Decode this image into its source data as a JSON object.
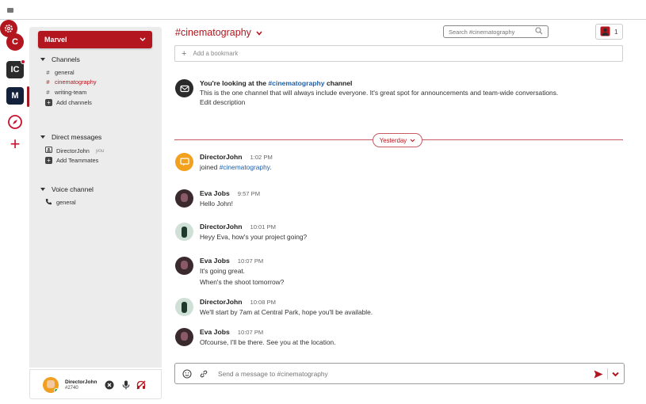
{
  "servers": [
    {
      "letter": "C",
      "name": "C"
    },
    {
      "letter": "IC",
      "name": "IC"
    },
    {
      "letter": "M",
      "name": "M"
    }
  ],
  "workspace": {
    "name": "Marvel"
  },
  "sidebar": {
    "channels_label": "Channels",
    "channels": [
      "general",
      "cinematography",
      "writing-team"
    ],
    "add_channels": "Add channels",
    "dm_label": "Direct messages",
    "dm_user": "DirectorJohn",
    "dm_you": "you",
    "add_teammates": "Add Teammates",
    "voice_label": "Voice channel",
    "voice_channels": [
      "general"
    ]
  },
  "user": {
    "name": "DirectorJohn",
    "tag": "#2740"
  },
  "header": {
    "channel": "#cinematography",
    "search_placeholder": "Search #cinematography",
    "member_count": "1",
    "bookmark": "Add a bookmark"
  },
  "intro": {
    "title_prefix": "You're looking at the ",
    "title_channel": "#cinematography",
    "title_suffix": " channel",
    "description": "This is the one channel that will always include everyone. It's great spot for announcements and team-wide conversations.",
    "edit": "Edit description"
  },
  "divider": {
    "label": "Yesterday"
  },
  "messages": [
    {
      "author": "DirectorJohn",
      "time": "1:02 PM",
      "lines": [
        "joined ",
        "#cinematography",
        "."
      ]
    },
    {
      "author": "Eva Jobs",
      "time": "9:57 PM",
      "lines": [
        "Hello John!"
      ]
    },
    {
      "author": "DirectorJohn",
      "time": "10:01 PM",
      "lines": [
        "Heyy Eva, how's your project going?"
      ]
    },
    {
      "author": "Eva Jobs",
      "time": "10:07 PM",
      "lines": [
        "It's going great.",
        "When's the shoot tomorrow?"
      ]
    },
    {
      "author": "DirectorJohn",
      "time": "10:08 PM",
      "lines": [
        "We'll start by 7am at Central Park, hope you'll be available."
      ]
    },
    {
      "author": "Eva Jobs",
      "time": "10:07 PM",
      "lines": [
        "Ofcourse, I'll be there. See you at the location."
      ]
    }
  ],
  "composer": {
    "placeholder": "Send a message to #cinematography"
  },
  "colors": {
    "accent": "#b3161e",
    "link": "#1f5ea8",
    "sidebar_bg": "#ececec"
  }
}
